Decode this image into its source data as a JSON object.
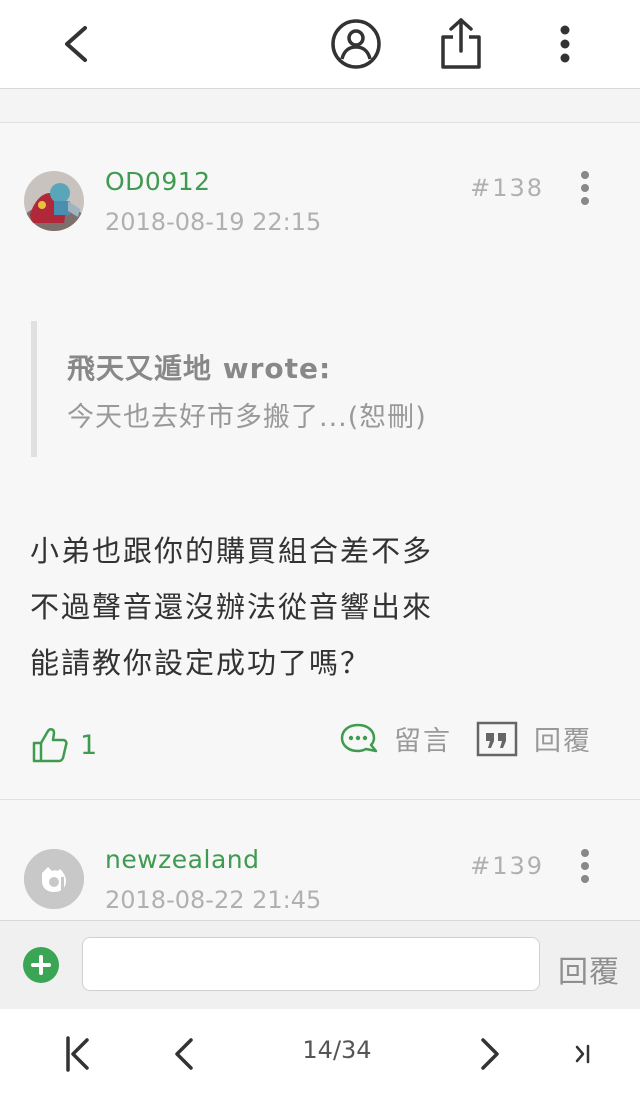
{
  "topbar": {
    "icons": [
      "back-icon",
      "user-circle-icon",
      "share-icon",
      "more-vertical-icon"
    ]
  },
  "posts": [
    {
      "username": "OD0912",
      "datetime": "2018-08-19 22:15",
      "floor": "#138",
      "quote": {
        "author": "飛天又遁地 wrote:",
        "text": "今天也去好市多搬了...(恕刪)"
      },
      "body": [
        "小弟也跟你的購買組合差不多",
        "不過聲音還沒辦法從音響出來",
        "能請教你設定成功了嗎？"
      ],
      "likes": "1",
      "comment_label": "留言",
      "reply_label": "回覆"
    },
    {
      "username": "newzealand",
      "datetime": "2018-08-22 21:45",
      "floor": "#139"
    }
  ],
  "compose": {
    "placeholder": "",
    "reply_label": "回覆"
  },
  "pagination": {
    "current": "14/34"
  },
  "colors": {
    "accent": "#3e9b4f",
    "plus_button": "#3aa655",
    "muted_text": "#b0b0b0"
  }
}
